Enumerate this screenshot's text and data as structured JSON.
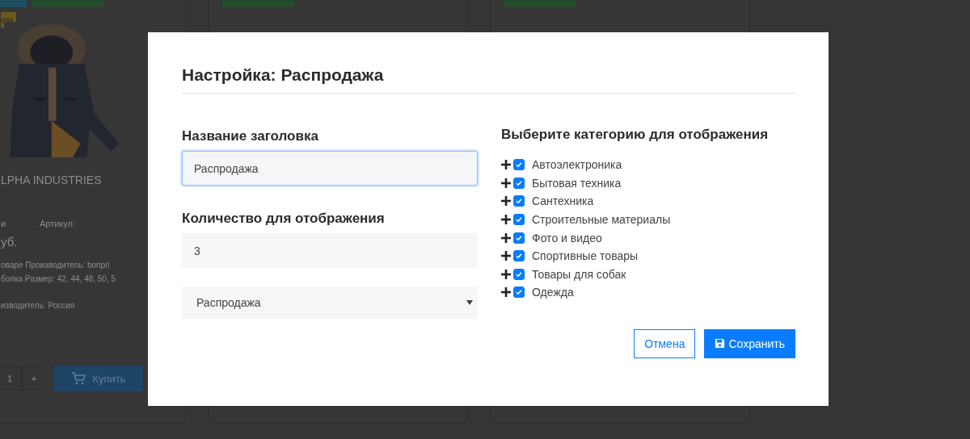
{
  "background": {
    "product_card": {
      "badge": "ем",
      "title": "LPHA INDUSTRIES",
      "meta_left": "и",
      "meta_right": "Артикул:",
      "price": "уб.",
      "details": [
        "оваре Производитель: bonpri",
        "болка Размер: 42, 44, 48, 50, 5",
        "изводитель: Россия"
      ],
      "quantity": "1",
      "plus": "+",
      "buy_button": "Купить"
    }
  },
  "modal": {
    "title": "Настройка: Распродажа",
    "title_field": {
      "label": "Название заголовка",
      "value": "Распродажа"
    },
    "count_field": {
      "label": "Количество для отображения",
      "value": "3"
    },
    "select": {
      "value": "Распродажа"
    },
    "categories_heading": "Выберите категорию для отображения",
    "categories": [
      {
        "label": "Автоэлектроника",
        "checked": true,
        "expanded": false
      },
      {
        "label": "Бытовая техника",
        "checked": true,
        "expanded": false
      },
      {
        "label": "Сантехника",
        "checked": true,
        "expanded": false
      },
      {
        "label": "Строительные материалы",
        "checked": true,
        "expanded": false
      },
      {
        "label": "Фото и видео",
        "checked": true,
        "expanded": false
      },
      {
        "label": "Спортивные товары",
        "checked": true,
        "expanded": false
      },
      {
        "label": "Товары для собак",
        "checked": true,
        "expanded": false
      },
      {
        "label": "Одежда",
        "checked": true,
        "expanded": false
      }
    ],
    "buttons": [
      {
        "kind": "secondary",
        "label": "Отмена"
      },
      {
        "kind": "primary",
        "label": "Сохранить"
      }
    ]
  }
}
